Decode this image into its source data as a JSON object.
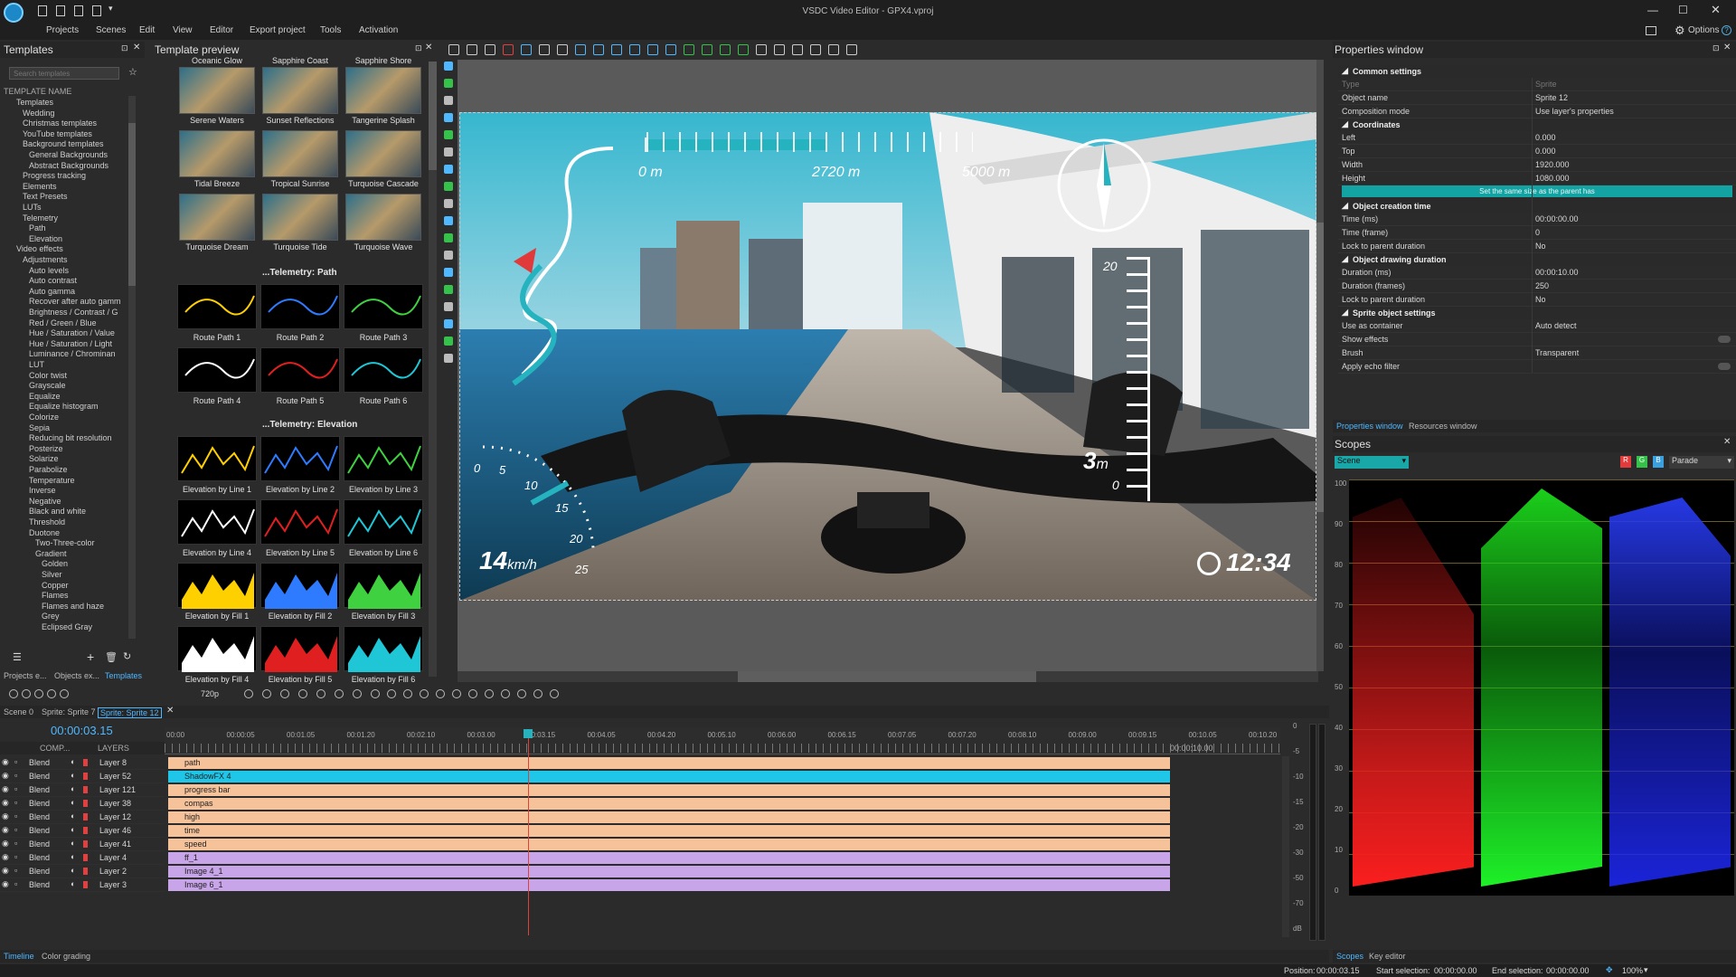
{
  "app": {
    "title": "VSDC Video Editor - GPX4.vproj",
    "options_label": "Options"
  },
  "menu": [
    "Projects",
    "Scenes",
    "Edit",
    "View",
    "Editor",
    "Export project",
    "Tools",
    "Activation"
  ],
  "templates_panel": {
    "title": "Templates",
    "search_placeholder": "Search templates",
    "tree_header": "TEMPLATE NAME",
    "tree": [
      "Templates",
      "Wedding",
      "Christmas templates",
      "YouTube templates",
      "Background templates",
      "General Backgrounds",
      "Abstract Backgrounds",
      "Progress tracking",
      "Elements",
      "Text Presets",
      "LUTs",
      "Telemetry",
      "Path",
      "Elevation",
      "Video effects",
      "Adjustments",
      "Auto levels",
      "Auto contrast",
      "Auto gamma",
      "Recover after auto gamm",
      "Brightness / Contrast / G",
      "Red / Green / Blue",
      "Hue / Saturation / Value",
      "Hue / Saturation / Light",
      "Luminance / Chrominan",
      "LUT",
      "Color twist",
      "Grayscale",
      "Equalize",
      "Equalize histogram",
      "Colorize",
      "Sepia",
      "Reducing bit resolution",
      "Posterize",
      "Solarize",
      "Parabolize",
      "Temperature",
      "Inverse",
      "Negative",
      "Black and white",
      "Threshold",
      "Duotone",
      "Two-Three-color",
      "Gradient",
      "Golden",
      "Silver",
      "Copper",
      "Flames",
      "Flames and haze",
      "Grey",
      "Eclipsed Gray"
    ],
    "bottom_tabs": [
      "Projects e...",
      "Objects ex...",
      "Templates"
    ]
  },
  "template_preview": {
    "title": "Template preview",
    "top_labels": [
      "Oceanic Glow",
      "Sapphire Coast",
      "Sapphire Shore"
    ],
    "rows": [
      [
        "Serene Waters",
        "Sunset Reflections",
        "Tangerine Splash"
      ],
      [
        "Tidal Breeze",
        "Tropical Sunrise",
        "Turquoise Cascade"
      ],
      [
        "Turquoise Dream",
        "Turquoise Tide",
        "Turquoise Wave"
      ]
    ],
    "path_section": "...Telemetry: Path",
    "path_items": [
      "Route Path 1",
      "Route Path 2",
      "Route Path 3",
      "Route Path 4",
      "Route Path 5",
      "Route Path 6"
    ],
    "elev_section": "...Telemetry: Elevation",
    "elev_items": [
      "Elevation by Line 1",
      "Elevation by Line 2",
      "Elevation by Line 3",
      "Elevation by Line 4",
      "Elevation by Line 5",
      "Elevation by Line 6",
      "Elevation by Fill 1",
      "Elevation by Fill 2",
      "Elevation by Fill 3",
      "Elevation by Fill 4",
      "Elevation by Fill 5",
      "Elevation by Fill 6"
    ]
  },
  "overlay": {
    "dist_start": "0 m",
    "dist_mid": "2720 m",
    "dist_end": "5000 m",
    "speed_value": "14",
    "speed_unit": "km/h",
    "speed_ticks": [
      "0",
      "5",
      "10",
      "15",
      "20",
      "25"
    ],
    "elev_value": "3",
    "elev_unit": "m",
    "elev_top": "20",
    "elev_bottom": "0",
    "clock": "12:34",
    "progress": 0.55
  },
  "playback": {
    "quality": "720p"
  },
  "scene_tabs": [
    "Scene 0",
    "Sprite: Sprite 7",
    "Sprite: Sprite 12"
  ],
  "timeline": {
    "time": "00:00:03.15",
    "header_comp": "COMP...",
    "header_layers": "LAYERS",
    "ruler": [
      "00:00",
      "00:00:05",
      "00:01.05",
      "00:01.20",
      "00:02.10",
      "00:03.00",
      "00:03.15",
      "00:04.05",
      "00:04.20",
      "00:05.10",
      "00:06.00",
      "00:06.15",
      "00:07.05",
      "00:07.20",
      "00:08.10",
      "00:09.00",
      "00:09.15",
      "00:10.05",
      "00:10.20"
    ],
    "end_marker": "00:00:10.00",
    "layers": [
      {
        "blend": "Blend",
        "layer": "Layer 8",
        "track": "path",
        "kind": "sprite"
      },
      {
        "blend": "Blend",
        "layer": "Layer 52",
        "track": "ShadowFX 4",
        "kind": "fx"
      },
      {
        "blend": "Blend",
        "layer": "Layer 121",
        "track": "progress bar",
        "kind": "sprite"
      },
      {
        "blend": "Blend",
        "layer": "Layer 38",
        "track": "compas",
        "kind": "sprite"
      },
      {
        "blend": "Blend",
        "layer": "Layer 12",
        "track": "high",
        "kind": "sprite"
      },
      {
        "blend": "Blend",
        "layer": "Layer 46",
        "track": "time",
        "kind": "sprite"
      },
      {
        "blend": "Blend",
        "layer": "Layer 41",
        "track": "speed",
        "kind": "sprite"
      },
      {
        "blend": "Blend",
        "layer": "Layer 4",
        "track": "ff_1",
        "kind": "image"
      },
      {
        "blend": "Blend",
        "layer": "Layer 2",
        "track": "Image 4_1",
        "kind": "image"
      },
      {
        "blend": "Blend",
        "layer": "Layer 3",
        "track": "Image 6_1",
        "kind": "image"
      }
    ],
    "db_scale": [
      "0",
      "-5",
      "-10",
      "-15",
      "-20",
      "-30",
      "-50",
      "-70",
      "dB"
    ]
  },
  "properties": {
    "title": "Properties window",
    "common": "Common settings",
    "type_k": "Type",
    "type_v": "Sprite",
    "name_k": "Object name",
    "name_v": "Sprite 12",
    "comp_k": "Composition mode",
    "comp_v": "Use layer's properties",
    "coords": "Coordinates",
    "left_k": "Left",
    "left_v": "0.000",
    "top_k": "Top",
    "top_v": "0.000",
    "width_k": "Width",
    "width_v": "1920.000",
    "height_k": "Height",
    "height_v": "1080.000",
    "same_size": "Set the same size as the parent has",
    "creation": "Object creation time",
    "time_ms_k": "Time (ms)",
    "time_ms_v": "00:00:00.00",
    "time_fr_k": "Time (frame)",
    "time_fr_v": "0",
    "lock1_k": "Lock to parent duration",
    "lock1_v": "No",
    "drawing": "Object drawing duration",
    "dur_ms_k": "Duration (ms)",
    "dur_ms_v": "00:00:10.00",
    "dur_fr_k": "Duration (frames)",
    "dur_fr_v": "250",
    "lock2_k": "Lock to parent duration",
    "lock2_v": "No",
    "sprite": "Sprite object settings",
    "container_k": "Use as container",
    "container_v": "Auto detect",
    "effects_k": "Show effects",
    "brush_k": "Brush",
    "brush_v": "Transparent",
    "echo_k": "Apply echo filter",
    "tabs": [
      "Properties window",
      "Resources window"
    ]
  },
  "scopes": {
    "title": "Scopes",
    "source": "Scene",
    "mode": "Parade",
    "scale": [
      "100",
      "90",
      "80",
      "70",
      "60",
      "50",
      "40",
      "30",
      "20",
      "10",
      "0"
    ],
    "tabs": [
      "Scopes",
      "Key editor"
    ]
  },
  "bottom_tabs": [
    "Timeline",
    "Color grading"
  ],
  "status": {
    "position": "Position:",
    "position_v": "00:00:03.15",
    "start": "Start selection:",
    "start_v": "00:00:00.00",
    "end": "End selection:",
    "end_v": "00:00:00.00",
    "zoom": "100%"
  }
}
